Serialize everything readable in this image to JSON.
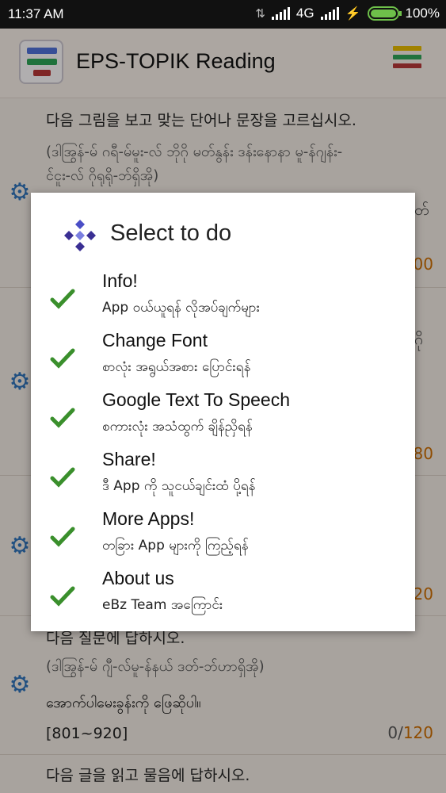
{
  "status": {
    "time": "11:37 AM",
    "network": "4G",
    "battery": "100%"
  },
  "app": {
    "title": "EPS-TOPIK Reading"
  },
  "list": [
    {
      "instruction": "다음 그림을 보고 맞는 단어나 문장을 고르십시오.",
      "instruction_my_1": "(ဒါအြွန်-မ် ဂရီ-မ်မူး-လ် ဘိုဂို မတ်နွန်း ဒန်းနောနာ မူ-န်ဂျန်း-",
      "instruction_my_2": "င်ငူး-လ် ဂိုရုရို-ဘ်ရှိအို)",
      "edge_text": "တ်",
      "count_total": "00"
    },
    {
      "edge_text": "ဂို",
      "count_total": "80"
    },
    {
      "count_total": "20"
    },
    {
      "instruction": "다음 질문에 답하시오.",
      "instruction_my_1": "(ဒါအြွန်-မ် ဂျီ-လ်မူ-န်နယ် ဒတ်-ဘ်ဟာရှိအို)",
      "instruction_my_2": "အောက်ပါမေးခွန်းကို ဖြေဆိုပါ။",
      "range": "[801~920]",
      "count_done": "0/",
      "count_total": "120"
    },
    {
      "instruction": "다음 글을 읽고 물음에 답하시오."
    }
  ],
  "dialog": {
    "title": "Select to do",
    "options": [
      {
        "label": "Info!",
        "sub": "App ဝယ်ယူရန် လိုအပ်ချက်များ"
      },
      {
        "label": "Change Font",
        "sub": "စာလုံး အရွယ်အစား ပြောင်းရန်"
      },
      {
        "label": "Google Text To Speech",
        "sub": "စကားလုံး အသံထွက် ချိန်ညှိရန်"
      },
      {
        "label": "Share!",
        "sub": "ဒီ App ကို သူငယ်ချင်းထံ ပို့ရန်"
      },
      {
        "label": "More Apps!",
        "sub": "တခြား App များကို ကြည့်ရန်"
      },
      {
        "label": "About us",
        "sub": "eBz Team အကြောင်း"
      }
    ]
  },
  "colors": {
    "check": "#3a8f2c",
    "gear": "#2f6fb3",
    "count_total": "#c76a00",
    "menu_top": "#e0b400",
    "menu_mid": "#2d9f55",
    "menu_bot": "#b03535"
  }
}
